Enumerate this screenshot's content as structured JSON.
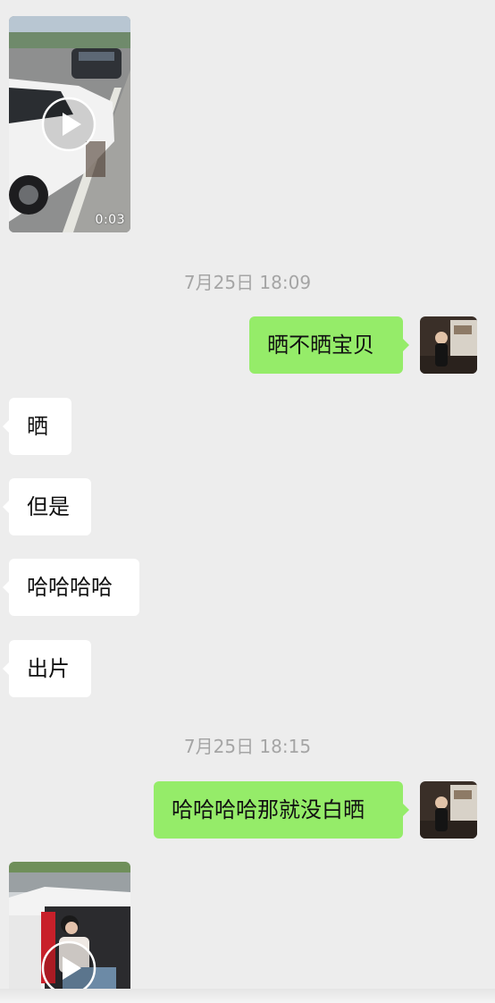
{
  "messages": {
    "video1": {
      "duration": "0:03",
      "icon": "play-icon"
    },
    "time1": "7月25日 18:09",
    "sent1": "晒不晒宝贝",
    "recv1": "晒",
    "recv2": "但是",
    "recv3": "哈哈哈哈",
    "recv4": "出片",
    "time2": "7月25日 18:15",
    "sent2": "哈哈哈哈那就没白晒",
    "video2": {
      "icon": "play-icon"
    }
  },
  "colors": {
    "background": "#ededed",
    "sent_bubble": "#95ec69",
    "received_bubble": "#ffffff",
    "timestamp_text": "#a5a5a5"
  }
}
